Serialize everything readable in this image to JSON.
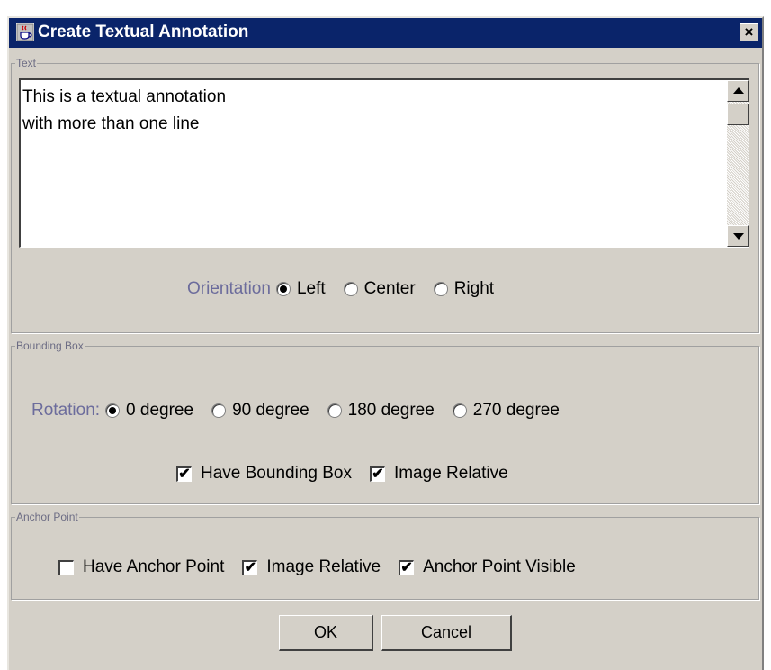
{
  "window": {
    "title": "Create Textual Annotation",
    "close_label": "×"
  },
  "text_group": {
    "title": "Text",
    "lines": [
      "This is a textual annotation",
      "with more than one line"
    ],
    "orientation_label": "Orientation",
    "orientation_options": [
      "Left",
      "Center",
      "Right"
    ],
    "orientation_selected": "Left"
  },
  "bounding_box_group": {
    "title": "Bounding Box",
    "rotation_label": "Rotation:",
    "rotation_options": [
      "0 degree",
      "90 degree",
      "180 degree",
      "270 degree"
    ],
    "rotation_selected": "0 degree",
    "have_bounding_box_label": "Have Bounding Box",
    "have_bounding_box_checked": true,
    "image_relative_label": "Image Relative",
    "image_relative_checked": true
  },
  "anchor_point_group": {
    "title": "Anchor Point",
    "have_anchor_point_label": "Have Anchor Point",
    "have_anchor_point_checked": false,
    "image_relative_label": "Image Relative",
    "image_relative_checked": true,
    "anchor_visible_label": "Anchor Point Visible",
    "anchor_visible_checked": true
  },
  "buttons": {
    "ok_label": "OK",
    "cancel_label": "Cancel"
  },
  "colors": {
    "titlebar": "#0a246a",
    "dialog_bg": "#d4d0c8",
    "group_label": "#6c6c9c"
  },
  "icons": {
    "app": "java-cup-icon",
    "checkmark": "✔"
  }
}
